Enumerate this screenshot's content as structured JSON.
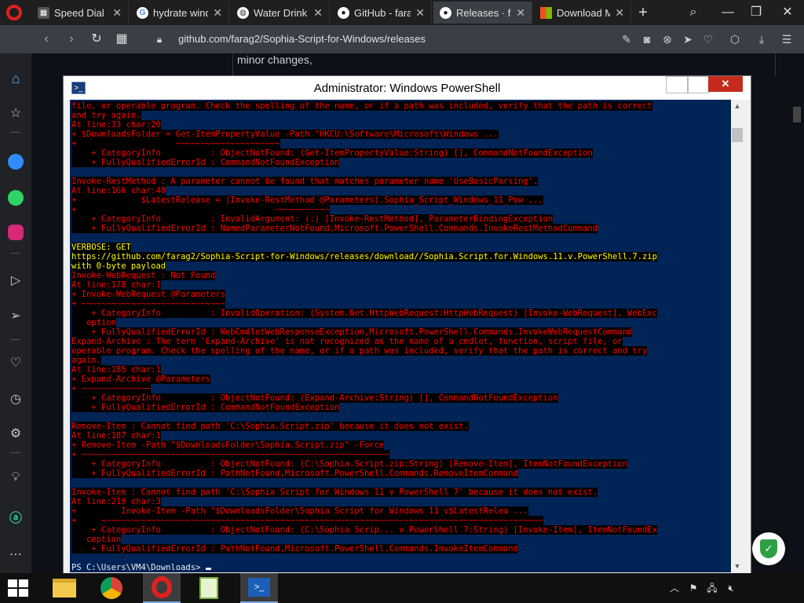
{
  "tabs": [
    {
      "title": "Speed Dial",
      "icon": "speed-dial-icon",
      "active": false
    },
    {
      "title": "hydrate windo",
      "icon": "google-icon",
      "active": false
    },
    {
      "title": "Water Drink R",
      "icon": "globe-icon",
      "active": false
    },
    {
      "title": "GitHub - farag",
      "icon": "github-icon",
      "active": false
    },
    {
      "title": "Releases · fara",
      "icon": "github-icon",
      "active": true
    },
    {
      "title": "Download Mic",
      "icon": "microsoft-icon",
      "active": false
    }
  ],
  "tab_close_glyph": "✕",
  "new_tab_glyph": "+",
  "address": {
    "url": "github.com/farag2/Sophia-Script-for-Windows/releases"
  },
  "page": {
    "partial_text": "minor changes,"
  },
  "powershell": {
    "title": "Administrator: Windows PowerShell",
    "close_glyph": "✕",
    "prompt": "PS C:\\Users\\VM4\\Downloads> ",
    "lines": [
      {
        "t": "err",
        "s": "file, or operable program. Check the spelling of the name, or if a path was included, verify that the path is correct"
      },
      {
        "t": "err",
        "s": "and try again."
      },
      {
        "t": "err",
        "s": "At line:33 char:20"
      },
      {
        "t": "err",
        "s": "+ $DownloadsFolder = Get-ItemPropertyValue -Path \"HKCU:\\Software\\Microsoft\\Windows ..."
      },
      {
        "t": "err",
        "s": "+                    ~~~~~~~~~~~~~~~~~~~~~"
      },
      {
        "t": "err",
        "s": "    + CategoryInfo          : ObjectNotFound: (Get-ItemPropertyValue:String) [], CommandNotFoundException"
      },
      {
        "t": "err",
        "s": "    + FullyQualifiedErrorId : CommandNotFoundException"
      },
      {
        "t": "blank",
        "s": ""
      },
      {
        "t": "err",
        "s": "Invoke-RestMethod : A parameter cannot be found that matches parameter name 'UseBasicParsing'."
      },
      {
        "t": "err",
        "s": "At line:166 char:40"
      },
      {
        "t": "err",
        "s": "+             $LatestRelease = (Invoke-RestMethod @Parameters).Sophia_Script_Windows_11_Pow ..."
      },
      {
        "t": "err",
        "s": "+                                        ~~~~~~~~~~~"
      },
      {
        "t": "err",
        "s": "    + CategoryInfo          : InvalidArgument: (:) [Invoke-RestMethod], ParameterBindingException"
      },
      {
        "t": "err",
        "s": "    + FullyQualifiedErrorId : NamedParameterNotFound,Microsoft.PowerShell.Commands.InvokeRestMethodCommand"
      },
      {
        "t": "blank",
        "s": ""
      },
      {
        "t": "vb",
        "s": "VERBOSE: GET"
      },
      {
        "t": "vb",
        "s": "https://github.com/farag2/Sophia-Script-for-Windows/releases/download//Sophia.Script.for.Windows.11.v.PowerShell.7.zip"
      },
      {
        "t": "vb",
        "s": "with 0-byte payload"
      },
      {
        "t": "err",
        "s": "Invoke-WebRequest : Not Found"
      },
      {
        "t": "err",
        "s": "At line:178 char:1"
      },
      {
        "t": "err",
        "s": "+ Invoke-WebRequest @Parameters"
      },
      {
        "t": "err",
        "s": "+ ~~~~~~~~~~~~~~~~~~~~~~~~~~~~~"
      },
      {
        "t": "err",
        "s": "    + CategoryInfo          : InvalidOperation: (System.Net.HttpWebRequest:HttpWebRequest) [Invoke-WebRequest], WebExc"
      },
      {
        "t": "err",
        "s": "   eption"
      },
      {
        "t": "err",
        "s": "    + FullyQualifiedErrorId : WebCmdletWebResponseException,Microsoft.PowerShell.Commands.InvokeWebRequestCommand"
      },
      {
        "t": "err",
        "s": "Expand-Archive : The term 'Expand-Archive' is not recognized as the name of a cmdlet, function, script file, or"
      },
      {
        "t": "err",
        "s": "operable program. Check the spelling of the name, or if a path was included, verify that the path is correct and try"
      },
      {
        "t": "err",
        "s": "again."
      },
      {
        "t": "err",
        "s": "At line:185 char:1"
      },
      {
        "t": "err",
        "s": "+ Expand-Archive @Parameters"
      },
      {
        "t": "err",
        "s": "+ ~~~~~~~~~~~~~~"
      },
      {
        "t": "err",
        "s": "    + CategoryInfo          : ObjectNotFound: (Expand-Archive:String) [], CommandNotFoundException"
      },
      {
        "t": "err",
        "s": "    + FullyQualifiedErrorId : CommandNotFoundException"
      },
      {
        "t": "blank",
        "s": ""
      },
      {
        "t": "err",
        "s": "Remove-Item : Cannot find path 'C:\\Sophia.Script.zip' because it does not exist."
      },
      {
        "t": "err",
        "s": "At line:187 char:1"
      },
      {
        "t": "err",
        "s": "+ Remove-Item -Path \"$DownloadsFolder\\Sophia.Script.zip\" -Force"
      },
      {
        "t": "err",
        "s": "+ ~~~~~~~~~~~~~~~~~~~~~~~~~~~~~~~~~~~~~~~~~~~~~~~~~~~~~~~~~~~~~~"
      },
      {
        "t": "err",
        "s": "    + CategoryInfo          : ObjectNotFound: (C:\\Sophia.Script.zip:String) [Remove-Item], ItemNotFoundException"
      },
      {
        "t": "err",
        "s": "    + FullyQualifiedErrorId : PathNotFound,Microsoft.PowerShell.Commands.RemoveItemCommand"
      },
      {
        "t": "blank",
        "s": ""
      },
      {
        "t": "err",
        "s": "Invoke-Item : Cannot find path 'C:\\Sophia Script for Windows 11 v PowerShell 7' because it does not exist."
      },
      {
        "t": "err",
        "s": "At line:219 char:3"
      },
      {
        "t": "err",
        "s": "+         Invoke-Item -Path \"$DownloadsFolder\\Sophia Script for Windows 11 v$LatestRelea ..."
      },
      {
        "t": "err",
        "s": "+     ~~~~~~~~~~~~~~~~~~~~~~~~~~~~~~~~~~~~~~~~~~~~~~~~~~~~~~~~~~~~~~~~~~~~~~~~~~~~~~~~~~~~~~~~~"
      },
      {
        "t": "err",
        "s": "    + CategoryInfo          : ObjectNotFound: (C:\\Sophia Scrip... v PowerShell 7:String) [Invoke-Item], ItemNotFoundEx"
      },
      {
        "t": "err",
        "s": "   ception"
      },
      {
        "t": "err",
        "s": "    + FullyQualifiedErrorId : PathNotFound,Microsoft.PowerShell.Commands.InvokeItemCommand"
      },
      {
        "t": "blank",
        "s": ""
      }
    ]
  },
  "colors": {
    "console_bg": "#012456",
    "error_fg": "#ff0000",
    "verbose_fg": "#ffff00",
    "prompt_fg": "#eeedf0",
    "opera_red": "#e0201f"
  }
}
